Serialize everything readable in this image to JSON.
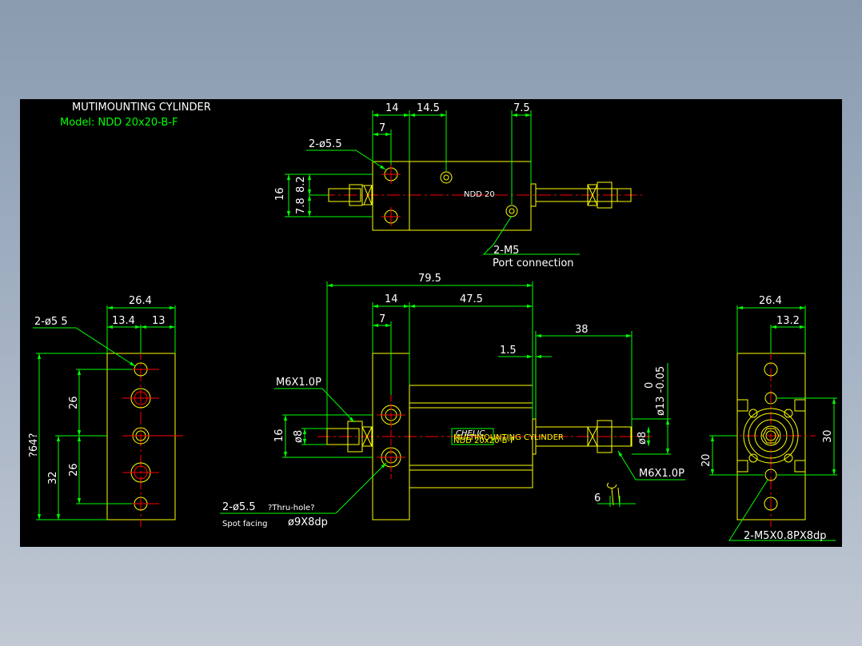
{
  "title_block": {
    "title": "MUTIMOUNTING CYLINDER",
    "model": "Model: NDD 20x20-B-F"
  },
  "colors": {
    "background": "#000000",
    "outline": "#ffff00",
    "dimension": "#00ff00",
    "centerline": "#ff0000",
    "text": "#ffffff"
  },
  "top_view": {
    "dims": [
      "14",
      "14.5",
      "7.5",
      "7",
      "16",
      "8.2",
      "7.8"
    ],
    "hole_callout": "2-ø5.5",
    "port_callout": "2-M5",
    "port_label": "Port connection",
    "body_mark": "NDD 20"
  },
  "front_view": {
    "dims": [
      "79.5",
      "14",
      "47.5",
      "7",
      "38",
      "1.5",
      "16",
      "ø8",
      "ø8",
      "6"
    ],
    "tolerance_upper": "0",
    "tolerance_main": "ø13 -0.05",
    "thread_left": "M6X1.0P",
    "thread_right": "M6X1.0P",
    "hole_callout": "2-ø5.5",
    "thru_hole": "?Thru-hole?",
    "spot_facing_label": "Spot facing",
    "spot_facing_size": "ø9X8dp",
    "label_brand": "CHELIC",
    "label_line1": "MULTIMOUNTING CYLINDER",
    "label_line2": "NDD 20x20-B-F"
  },
  "left_view": {
    "dims": [
      "26.4",
      "13.4",
      "13",
      "26",
      "26",
      "32",
      "?64?"
    ],
    "hole_callout": "2-ø5 5"
  },
  "right_view": {
    "dims": [
      "26.4",
      "13.2",
      "30",
      "20"
    ],
    "thread_callout": "2-M5X0.8PX8dp"
  }
}
